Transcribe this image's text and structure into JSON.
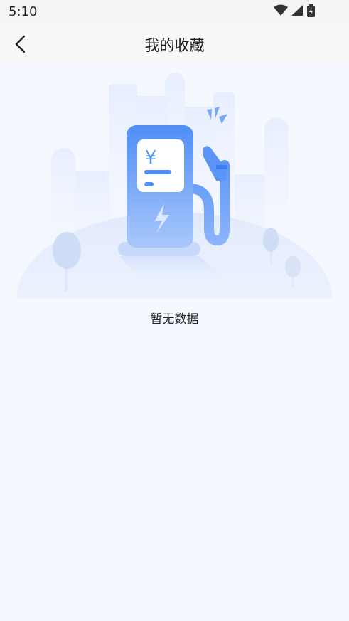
{
  "status_bar": {
    "time": "5:10",
    "icons": [
      "wifi-icon",
      "cellular-signal-icon",
      "battery-charging-icon"
    ]
  },
  "app_bar": {
    "back_icon": "chevron-left-icon",
    "title": "我的收藏"
  },
  "empty_state": {
    "illustration": "charging-station-illustration",
    "message": "暂无数据"
  },
  "colors": {
    "background": "#f5f8ff",
    "accent": "#4f8ef7"
  }
}
